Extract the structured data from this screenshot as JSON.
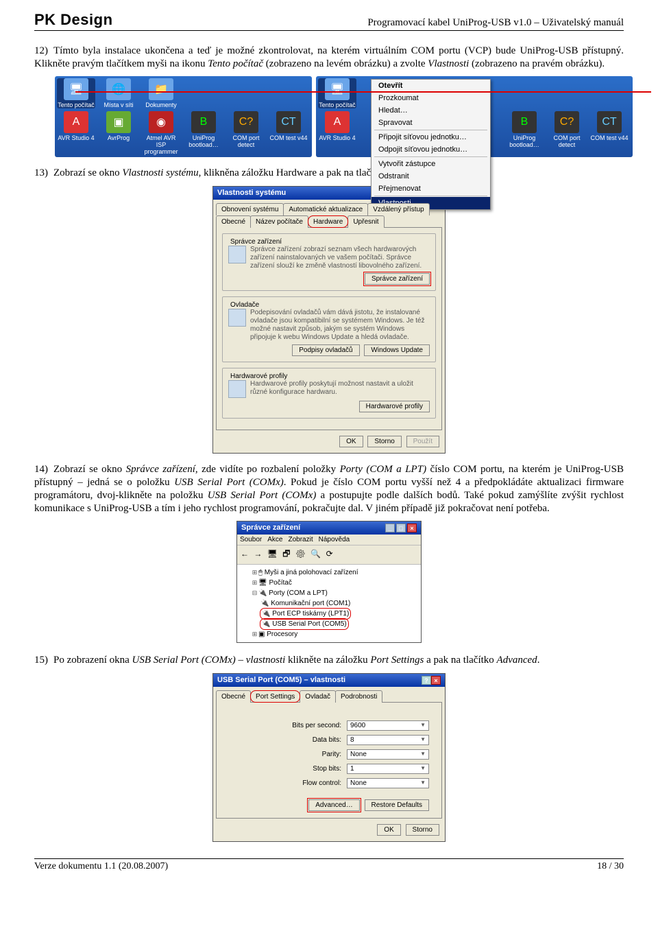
{
  "header": {
    "brand": "PK Design",
    "title": "Programovací kabel UniProg-USB v1.0 – Uživatelský manuál"
  },
  "p12": {
    "idx": "12)",
    "t1": "Tímto byla instalace ukončena a teď je možné  zkontrolovat, na kterém virtuálním COM portu (VCP) bude UniProg-USB přístupný. Klikněte pravým tlačítkem myši na ikonu ",
    "i1": "Tento počítač",
    "t2": " (zobrazeno na levém obrázku) a zvolte ",
    "i2": "Vlastnosti",
    "t3": " (zobrazeno na pravém obrázku)."
  },
  "desk": {
    "row1": [
      {
        "lbl": "Tento počítač",
        "name": "tentoPC"
      },
      {
        "lbl": "Místa v síti",
        "name": "mistavsiti"
      },
      {
        "lbl": "Dokumenty",
        "name": "dokumenty"
      }
    ],
    "row2": [
      {
        "lbl": "AVR Studio 4",
        "name": "avrstudio"
      },
      {
        "lbl": "AvrProg",
        "name": "avrprog"
      },
      {
        "lbl": "Atmel AVR ISP programmer",
        "name": "atmelavr"
      },
      {
        "lbl": "UniProg bootload…",
        "name": "uniprog"
      },
      {
        "lbl": "COM port detect",
        "name": "comport"
      },
      {
        "lbl": "COM test v44",
        "name": "comtest"
      }
    ],
    "menu": [
      {
        "t": "Otevřít",
        "b": true
      },
      {
        "t": "Prozkoumat"
      },
      {
        "t": "Hledat…"
      },
      {
        "t": "Spravovat"
      },
      {
        "hr": true
      },
      {
        "t": "Připojit síťovou jednotku…"
      },
      {
        "t": "Odpojit síťovou jednotku…"
      },
      {
        "hr": true
      },
      {
        "t": "Vytvořit zástupce"
      },
      {
        "t": "Odstranit"
      },
      {
        "t": "Přejmenovat"
      },
      {
        "hr": true
      },
      {
        "t": "Vlastnosti",
        "hl": true
      }
    ]
  },
  "p13": {
    "idx": "13)",
    "t1": "Zobrazí se okno ",
    "i1": "Vlastnosti systému",
    "t2": ", klikněna záložku Hardware a pak na tlačítko Správce zařízení."
  },
  "sysprop": {
    "title": "Vlastnosti systému",
    "tabs_top": [
      "Obnovení systému",
      "Automatické aktualizace",
      "Vzdálený přístup"
    ],
    "tabs_bot": [
      "Obecné",
      "Název počítače",
      "Hardware",
      "Upřesnit"
    ],
    "g1": {
      "title": "Správce zařízení",
      "txt": "Správce zařízení zobrazí seznam všech hardwarových zařízení nainstalovaných ve vašem počítači. Správce zařízení slouží ke změně vlastností libovolného zařízení.",
      "btn": "Správce zařízení"
    },
    "g2": {
      "title": "Ovladače",
      "txt": "Podepisování ovladačů vám dává jistotu, že instalované ovladače jsou kompatibilní se systémem Windows. Je též možné nastavit způsob, jakým se systém Windows připojuje k webu Windows Update a hledá ovladače.",
      "b1": "Podpisy ovladačů",
      "b2": "Windows Update"
    },
    "g3": {
      "title": "Hardwarové profily",
      "txt": "Hardwarové profily poskytují možnost nastavit a uložit různé konfigurace hardwaru.",
      "btn": "Hardwarové profily"
    },
    "foot": [
      "OK",
      "Storno",
      "Použít"
    ]
  },
  "p14": {
    "idx": "14)",
    "t1": "Zobrazí se okno ",
    "i1": "Správce zařízení",
    "t2": ", zde vidíte po rozbalení položky ",
    "i2": "Porty (COM a LPT)",
    "t3": " číslo COM portu, na kterém je UniProg-USB přístupný – jedná se o položku ",
    "i3": "USB Serial Port (COMx)",
    "t4": ". Pokud je číslo COM portu vyšší než 4 a předpokládáte aktualizaci firmware programátoru, dvoj-klikněte na položku ",
    "i4": "USB Serial Port (COMx)",
    "t5": " a postupujte podle dalších bodů. Také pokud zamýšlíte zvýšit rychlost komunikace s UniProg-USB a tím i jeho rychlost programování, pokračujte dal. V jiném případě již pokračovat není potřeba."
  },
  "devmgr": {
    "title": "Správce zařízení",
    "menubar": [
      "Soubor",
      "Akce",
      "Zobrazit",
      "Nápověda"
    ],
    "tree": [
      {
        "lvl": 1,
        "pre": "⊞",
        "t": "Myši a jiná polohovací zařízení"
      },
      {
        "lvl": 1,
        "pre": "⊞",
        "t": "Počítač"
      },
      {
        "lvl": 1,
        "pre": "⊟",
        "t": "Porty (COM a LPT)"
      },
      {
        "lvl": 2,
        "pre": "",
        "t": "Komunikační port (COM1)"
      },
      {
        "lvl": 2,
        "pre": "",
        "t": "Port ECP tiskárny (LPT1)",
        "red": true
      },
      {
        "lvl": 2,
        "pre": "",
        "t": "USB Serial Port (COM5)",
        "red": true
      },
      {
        "lvl": 1,
        "pre": "⊞",
        "t": "Procesory"
      }
    ]
  },
  "p15": {
    "idx": "15)",
    "t1": "Po zobrazení okna ",
    "i1": "USB Serial Port (COMx) – vlastnosti",
    "t2": " klikněte na záložku ",
    "i2": "Port Settings",
    "t3": " a pak na tlačítko ",
    "i3": "Advanced",
    "t4": "."
  },
  "portset": {
    "title": "USB Serial Port (COM5) – vlastnosti",
    "tabs": [
      "Obecné",
      "Port Settings",
      "Ovladač",
      "Podrobnosti"
    ],
    "fields": [
      {
        "l": "Bits per second:",
        "v": "9600"
      },
      {
        "l": "Data bits:",
        "v": "8"
      },
      {
        "l": "Parity:",
        "v": "None"
      },
      {
        "l": "Stop bits:",
        "v": "1"
      },
      {
        "l": "Flow control:",
        "v": "None"
      }
    ],
    "adv": "Advanced…",
    "rst": "Restore Defaults",
    "foot": [
      "OK",
      "Storno"
    ]
  },
  "footer": {
    "left": "Verze dokumentu 1.1 (20.08.2007)",
    "right": "18 / 30"
  }
}
